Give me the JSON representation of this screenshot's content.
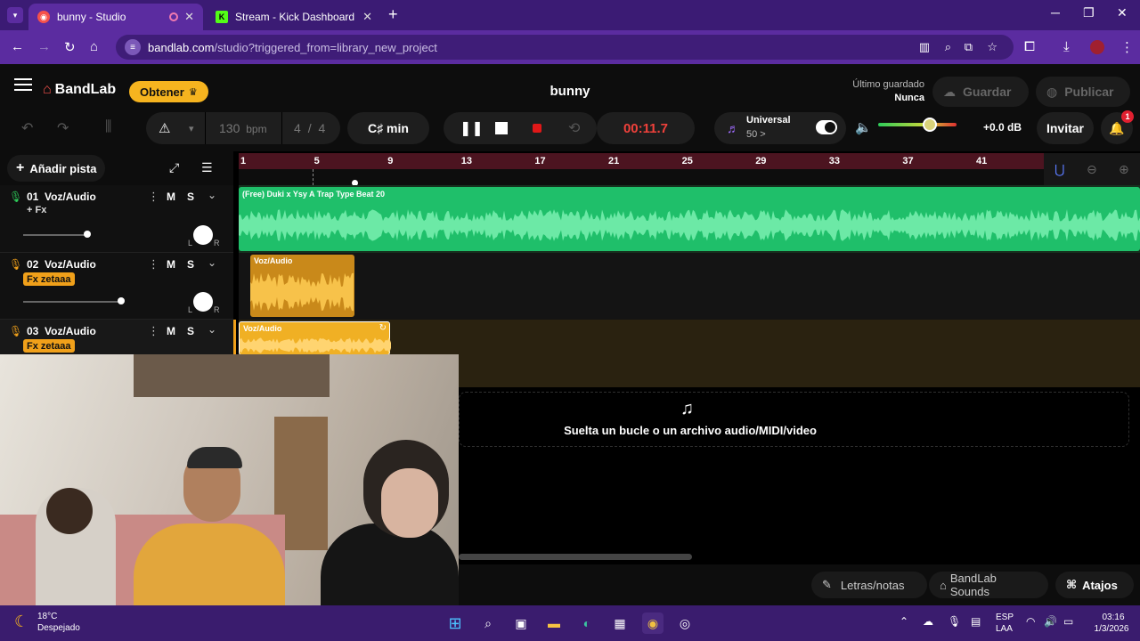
{
  "browser": {
    "tabs": [
      {
        "label": "bunny - Studio",
        "active": true
      },
      {
        "label": "Stream - Kick Dashboard",
        "active": false
      }
    ],
    "new_tab": "+",
    "url_domain": "bandlab.com",
    "url_path": "/studio?triggered_from=library_new_project"
  },
  "header": {
    "logo": "BandLab",
    "obtener_label": "Obtener",
    "project_title": "bunny",
    "last_saved_label": "Último guardado",
    "last_saved_value": "Nunca",
    "save_label": "Guardar",
    "publish_label": "Publicar"
  },
  "toolbar": {
    "bpm_value": "130",
    "bpm_unit": "bpm",
    "time_sig_num": "4",
    "time_sig_sep": "/",
    "time_sig_den": "4",
    "key": "C♯ min",
    "time_display": "00:11.7",
    "preset_name": "Universal",
    "preset_value": "50 >",
    "db_value": "+0.0 dB",
    "invite_label": "Invitar",
    "notif_count": "1"
  },
  "tracks_header": {
    "add_track_label": "Añadir pista"
  },
  "ruler_ticks": [
    "1",
    "5",
    "9",
    "13",
    "17",
    "21",
    "25",
    "29",
    "33",
    "37",
    "41"
  ],
  "tracks": [
    {
      "number": "01",
      "name": "Voz/Audio",
      "fx": "+ Fx",
      "fx_badge": false,
      "mute": "M",
      "solo": "S",
      "pan_l": "L",
      "pan_r": "R"
    },
    {
      "number": "02",
      "name": "Voz/Audio",
      "fx": "Fx zetaaa",
      "fx_badge": true,
      "mute": "M",
      "solo": "S",
      "pan_l": "L",
      "pan_r": "R"
    },
    {
      "number": "03",
      "name": "Voz/Audio",
      "fx": "Fx zetaaa",
      "fx_badge": true,
      "mute": "M",
      "solo": "S"
    }
  ],
  "regions": {
    "track1": "(Free) Duki  x Ysy A  Trap Type Beat  20",
    "track2": "Voz/Audio",
    "track3": "Voz/Audio"
  },
  "dropzone_text": "Suelta un bucle o un archivo audio/MIDI/video",
  "bottom": {
    "lyrics_label": "Letras/notas",
    "sounds_label": "BandLab Sounds",
    "shortcuts_label": "Atajos"
  },
  "taskbar": {
    "weather_temp": "18°C",
    "weather_desc": "Despejado",
    "lang_top": "ESP",
    "lang_bottom": "LAA",
    "time": "03:16",
    "date": "1/3/2026"
  },
  "colors": {
    "brand_red": "#f5514b",
    "accent_yellow": "#f6b41f",
    "track1_green": "#1fbf6a",
    "track_orange": "#f0a01a",
    "ruler_red": "#4c1420"
  }
}
